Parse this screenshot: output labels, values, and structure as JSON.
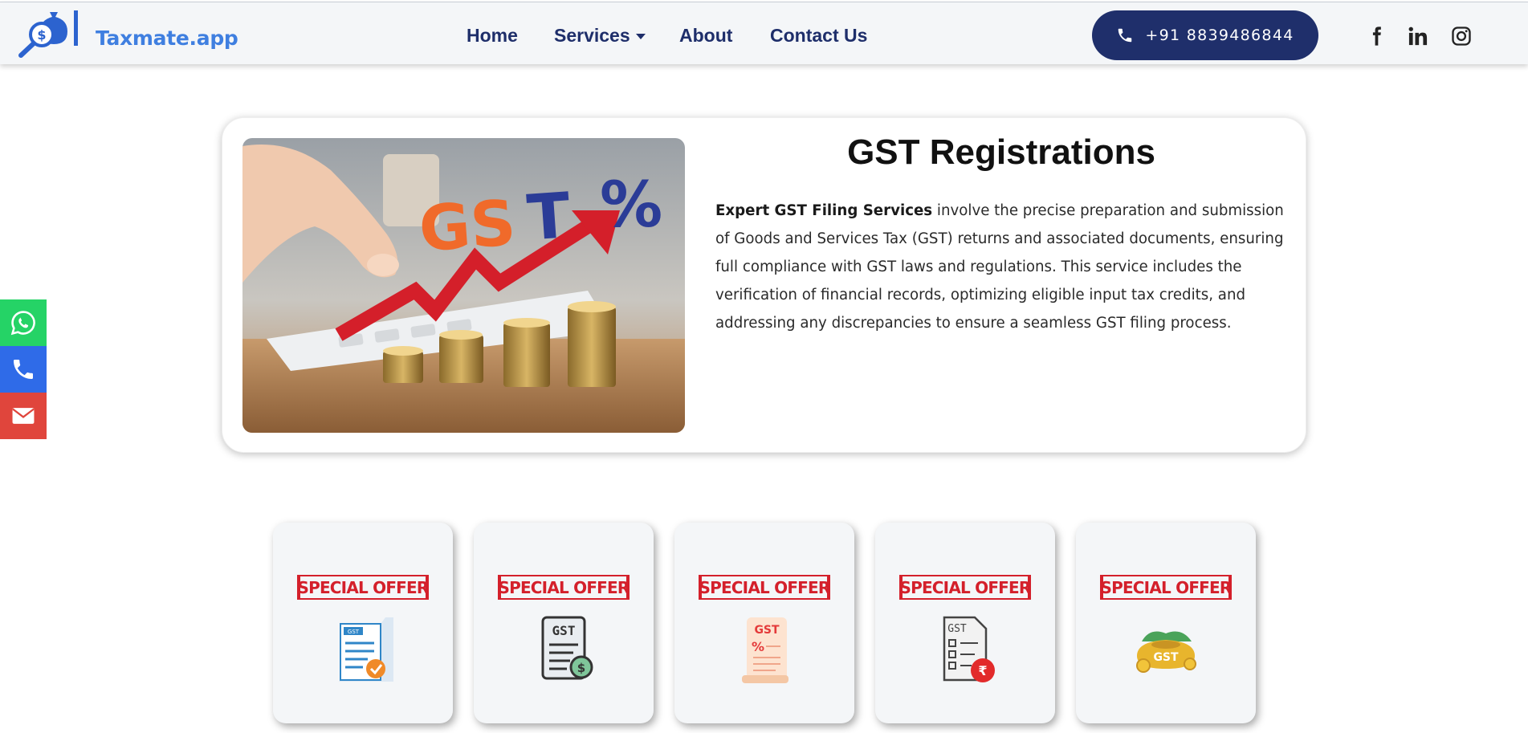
{
  "header": {
    "logo_text": "Taxmate.app",
    "nav": [
      {
        "label": "Home"
      },
      {
        "label": "Services",
        "has_dropdown": true
      },
      {
        "label": "About"
      },
      {
        "label": "Contact Us"
      }
    ],
    "phone_label": "+91 8839486844",
    "social_icons": [
      "facebook-icon",
      "linkedin-icon",
      "instagram-icon"
    ]
  },
  "side_contacts": [
    {
      "icon": "whatsapp-icon",
      "color": "#25d366"
    },
    {
      "icon": "phone-icon",
      "color": "#2f6be8"
    },
    {
      "icon": "email-icon",
      "color": "#e0453c"
    }
  ],
  "main": {
    "title": "GST Registrations",
    "desc_strong": "Expert GST Filing Services",
    "desc_rest": " involve the precise preparation and submission of Goods and Services Tax (GST) returns and associated documents, ensuring full compliance with GST laws and regulations. This service includes the verification of financial records, optimizing eligible input tax credits, and addressing any discrepancies to ensure a seamless GST filing process.",
    "hero_label": "GST %"
  },
  "offers": [
    {
      "badge": "SPECIAL OFFER",
      "icon": "gst-scroll-check-icon"
    },
    {
      "badge": "SPECIAL OFFER",
      "icon": "gst-document-dollar-icon"
    },
    {
      "badge": "SPECIAL OFFER",
      "icon": "gst-percent-scroll-icon"
    },
    {
      "badge": "SPECIAL OFFER",
      "icon": "gst-checklist-rupee-icon"
    },
    {
      "badge": "SPECIAL OFFER",
      "icon": "gst-gold-money-bag-icon"
    }
  ],
  "colors": {
    "brand_navy": "#1f2f6b",
    "logo_blue": "#3f7fe0",
    "offer_red": "#d4202b",
    "whatsapp": "#25d366",
    "phone": "#2f6be8",
    "email": "#e0453c"
  }
}
